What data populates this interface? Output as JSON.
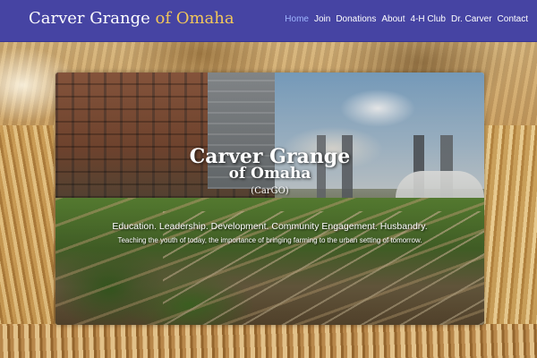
{
  "brand": {
    "name": "Carver Grange",
    "suffix": "of Omaha"
  },
  "nav": {
    "items": [
      {
        "label": "Home",
        "active": true
      },
      {
        "label": "Join",
        "active": false
      },
      {
        "label": "Donations",
        "active": false
      },
      {
        "label": "About",
        "active": false
      },
      {
        "label": "4-H Club",
        "active": false
      },
      {
        "label": "Dr. Carver",
        "active": false
      },
      {
        "label": "Contact",
        "active": false
      }
    ]
  },
  "hero": {
    "title": "Carver Grange",
    "subtitle": "of Omaha",
    "abbreviation": "(CarGO)",
    "pillars": "Education. Leadership. Development. Community Engagement. Husbandry.",
    "tagline": "Teaching the youth of today, the importance of bringing farming to the urban setting of tomorrow."
  },
  "colors": {
    "navbar": "#4644a3",
    "brand_accent": "#f2c75a",
    "nav_active": "#9fb6ff",
    "nav_text": "#ffffff"
  }
}
